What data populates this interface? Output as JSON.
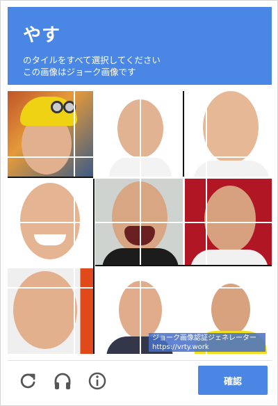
{
  "header": {
    "title": "やす",
    "instruction_line1": "のタイルをすべて選択してください",
    "instruction_line2": "この画像はジョーク画像です"
  },
  "watermark": {
    "line1": "ジョーク画像認証ジェネレーター",
    "line2": "https://vrty.work"
  },
  "footer": {
    "reload_icon": "reload-icon",
    "audio_icon": "headphones-icon",
    "info_icon": "info-icon",
    "verify_label": "確認"
  },
  "colors": {
    "accent": "#4a86e3",
    "divider": "#e0e0e0"
  }
}
